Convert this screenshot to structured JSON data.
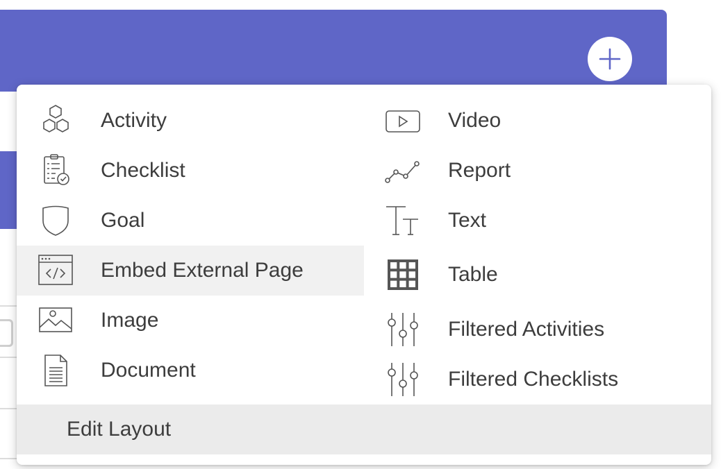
{
  "menu": {
    "left_items": [
      {
        "label": "Activity",
        "icon": "hexagons-icon"
      },
      {
        "label": "Checklist",
        "icon": "clipboard-check-icon"
      },
      {
        "label": "Goal",
        "icon": "shield-icon"
      },
      {
        "label": "Embed External Page",
        "icon": "code-window-icon"
      },
      {
        "label": "Image",
        "icon": "image-icon"
      },
      {
        "label": "Document",
        "icon": "document-icon"
      }
    ],
    "right_items": [
      {
        "label": "Video",
        "icon": "video-play-icon"
      },
      {
        "label": "Report",
        "icon": "line-chart-icon"
      },
      {
        "label": "Text",
        "icon": "text-size-icon"
      },
      {
        "label": "Table",
        "icon": "table-grid-icon"
      },
      {
        "label": "Filtered Activities",
        "icon": "sliders-icon"
      },
      {
        "label": "Filtered Checklists",
        "icon": "sliders-icon"
      }
    ],
    "edit_layout_label": "Edit Layout",
    "hovered_item": "Embed External Page"
  },
  "header": {
    "accent_color": "#5f66c7",
    "add_button_icon": "plus-icon"
  }
}
